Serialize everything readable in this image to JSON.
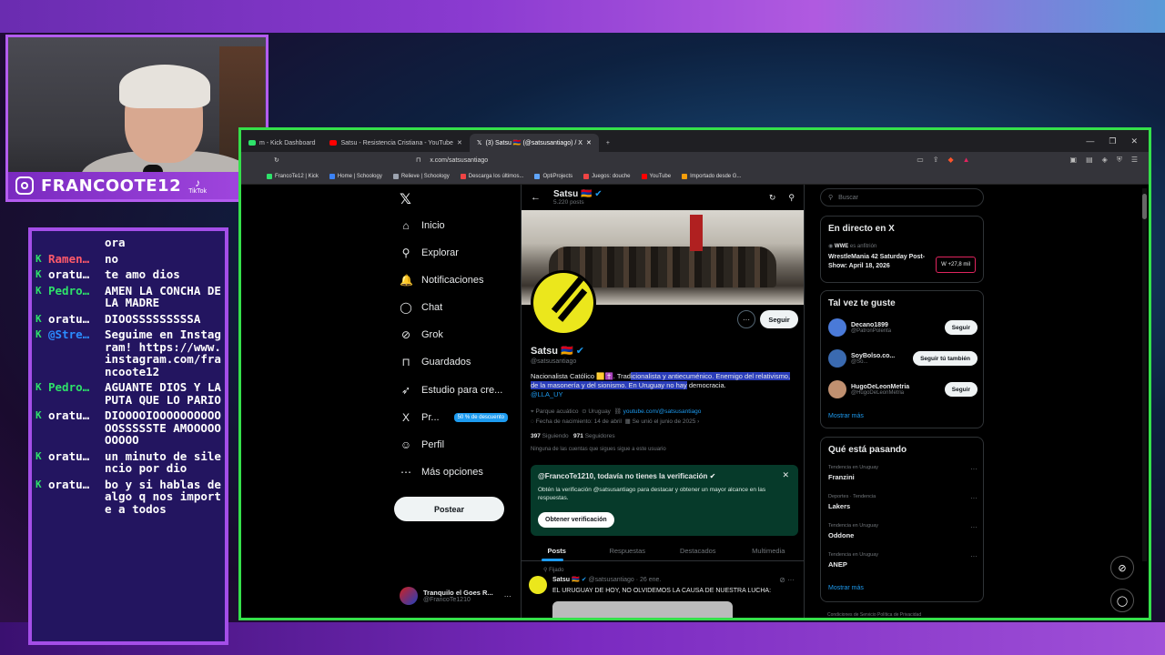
{
  "stream": {
    "handle": "FRANCOOTE12",
    "tiktok_label": "TikTok",
    "chat": [
      {
        "user": "",
        "message": "ora",
        "user_color": "#ffffff"
      },
      {
        "user": "Ramen…",
        "message": "no",
        "user_color": "#ff5a6a"
      },
      {
        "user": "oratu…",
        "message": "te amo dios",
        "user_color": "#ffffff"
      },
      {
        "user": "Pedro…",
        "message": "AMEN LA CONCHA DE LA MADRE",
        "user_color": "#2ee26a"
      },
      {
        "user": "oratu…",
        "message": "DIOOSSSSSSSSSA",
        "user_color": "#ffffff"
      },
      {
        "user": "@Stre…",
        "message": "Seguime en Instagram! https://www.instagram.com/francoote12",
        "user_color": "#2b8cff"
      },
      {
        "user": "Pedro…",
        "message": "AGUANTE DIOS Y LA PUTA QUE LO PARIO",
        "user_color": "#2ee26a"
      },
      {
        "user": "oratu…",
        "message": "DIOOOOIOOOOOOOOOOOOSSSSSTE AMOOOOOOOOOO",
        "user_color": "#ffffff"
      },
      {
        "user": "oratu…",
        "message": "un minuto de silencio por dio",
        "user_color": "#ffffff"
      },
      {
        "user": "oratu…",
        "message": "bo y si hablas de algo q nos importe a todos",
        "user_color": "#ffffff"
      }
    ]
  },
  "browser": {
    "tabs": [
      {
        "label": "m - Kick Dashboard",
        "color": "#2ee26a"
      },
      {
        "label": "Satsu - Resistencia Cristiana - YouTube",
        "color": "#ff0000"
      },
      {
        "label": "(3) Satsu 🇦🇲 (@satsusantiago) / X",
        "color": "#ffffff"
      }
    ],
    "url": "x.com/satsusantiago",
    "bookmarks": [
      {
        "label": "FrancoTe12 | Kick",
        "color": "#2ee26a"
      },
      {
        "label": "Home | Schoology",
        "color": "#3b82f6"
      },
      {
        "label": "Relieve | Schoology",
        "color": "#9ca3af"
      },
      {
        "label": "Descarga los últimos...",
        "color": "#ef4444"
      },
      {
        "label": "OptiProjects",
        "color": "#60a5fa"
      },
      {
        "label": "Juegos: douche",
        "color": "#ef4444"
      },
      {
        "label": "YouTube",
        "color": "#ff0000"
      },
      {
        "label": "Importado desde G...",
        "color": "#f59e0b"
      }
    ]
  },
  "nav": {
    "items": [
      {
        "label": "Inicio",
        "icon": "home-icon",
        "glyph": "⌂"
      },
      {
        "label": "Explorar",
        "icon": "search-icon",
        "glyph": "⚲"
      },
      {
        "label": "Notificaciones",
        "icon": "bell-icon",
        "glyph": "🔔"
      },
      {
        "label": "Chat",
        "icon": "chat-icon",
        "glyph": "◯"
      },
      {
        "label": "Grok",
        "icon": "grok-icon",
        "glyph": "⊘"
      },
      {
        "label": "Guardados",
        "icon": "bookmark-icon",
        "glyph": "⊓"
      },
      {
        "label": "Estudio para cre...",
        "icon": "rocket-icon",
        "glyph": "➶"
      },
      {
        "label": "Pr...",
        "icon": "x-premium-icon",
        "glyph": "X"
      },
      {
        "label": "Perfil",
        "icon": "person-icon",
        "glyph": "☺"
      },
      {
        "label": "Más opciones",
        "icon": "more-icon",
        "glyph": "⋯"
      }
    ],
    "premium_badge": "50 % de descuento",
    "post_label": "Postear",
    "account_name": "Tranquilo el Goes R...",
    "account_handle": "@FrancoTe1210"
  },
  "profile": {
    "name": "Satsu 🇦🇲",
    "post_count": "5.220 posts",
    "handle": "@satsusantiago",
    "follow_label": "Seguir",
    "bio_plain": "Nacionalista Católico 🟨✝️. Trad",
    "bio_selected": "icionalista y antiecuménico. Enemigo del relativismo, de la masonería y del sionismo. En Uruguay no hay",
    "bio_end": " democracia.",
    "bio_link": "@LLA_UY",
    "location": "Parque acuático",
    "country": "Uruguay",
    "website": "youtube.com/@satsusantiago",
    "birth": "Fecha de nacimiento: 14 de abril",
    "joined": "Se unió el junio de 2025",
    "following_count": "397",
    "following_label": "Siguiendo",
    "followers_count": "971",
    "followers_label": "Seguidores",
    "no_follow_note": "Ninguna de las cuentas que sigues sigue a este usuario",
    "verify_title": "@FrancoTe1210, todavía no tienes la verificación",
    "verify_body": "Obtén la verificación @satsusantiago para destacar y obtener un mayor alcance en las respuestas.",
    "verify_button": "Obtener verificación",
    "tabs": [
      "Posts",
      "Respuestas",
      "Destacados",
      "Multimedia"
    ],
    "pinned_label": "Fijado",
    "tweet_author": "Satsu 🇦🇲",
    "tweet_meta": "@satsusantiago · 26 ene.",
    "tweet_text": "EL URUGUAY DE HOY, NO OLVIDEMOS LA CAUSA DE NUESTRA LUCHA:"
  },
  "sidebar": {
    "search_placeholder": "Buscar",
    "live_title": "En directo en X",
    "live_host": "WWE",
    "live_host_suffix": " es anfitrión",
    "live_event": "WrestleMania 42 Saturday Post-Show: April 18, 2026",
    "live_count": "+27,8 mil",
    "who_title": "Tal vez te guste",
    "who": [
      {
        "name": "Decano1899",
        "handle": "@PatronPolenta",
        "button": "Seguir",
        "color": "#4a7ad8"
      },
      {
        "name": "SoyBolso.co...",
        "handle": "@So...",
        "button": "Seguir tú también",
        "color": "#3a6ab0"
      },
      {
        "name": "HugoDeLeonMetria",
        "handle": "@HugoDeLeonMetria",
        "button": "Seguir",
        "color": "#c09070"
      }
    ],
    "who_more": "Mostrar más",
    "trends_title": "Qué está pasando",
    "trends": [
      {
        "context": "Tendencia en Uruguay",
        "name": "Franzini"
      },
      {
        "context": "Deportes · Tendencia",
        "name": "Lakers"
      },
      {
        "context": "Tendencia en Uruguay",
        "name": "Oddone"
      },
      {
        "context": "Tendencia en Uruguay",
        "name": "ANEP"
      }
    ],
    "trends_more": "Mostrar más",
    "footer": "Condiciones de Servicio   Política de Privacidad"
  }
}
